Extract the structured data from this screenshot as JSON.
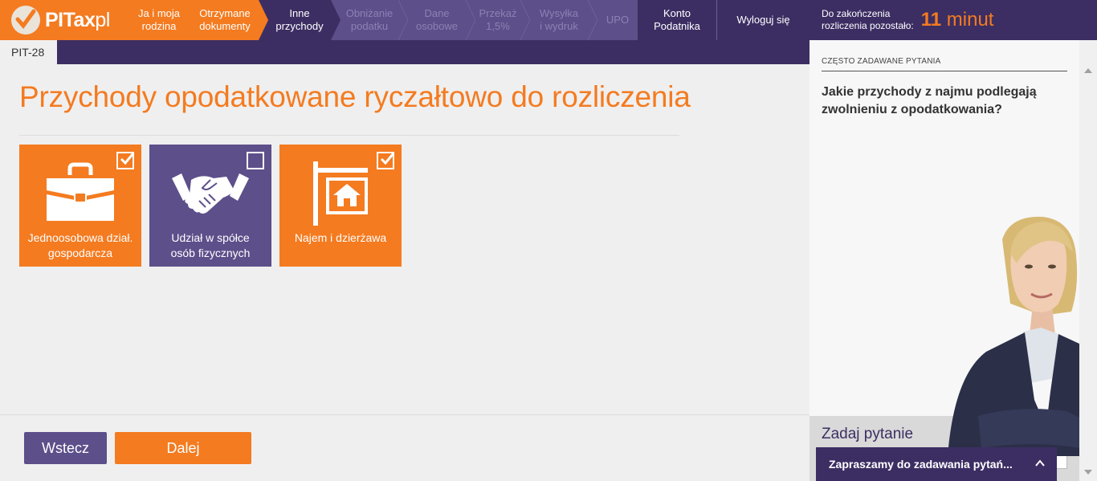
{
  "brand": {
    "name": "PITax",
    "suffix": "pl"
  },
  "nav": {
    "steps": [
      {
        "label_l1": "Ja i moja",
        "label_l2": "rodzina",
        "state": "done"
      },
      {
        "label_l1": "Otrzymane",
        "label_l2": "dokumenty",
        "state": "done"
      },
      {
        "label_l1": "Inne",
        "label_l2": "przychody",
        "state": "active"
      },
      {
        "label_l1": "Obniżanie",
        "label_l2": "podatku",
        "state": "disabled"
      },
      {
        "label_l1": "Dane",
        "label_l2": "osobowe",
        "state": "disabled"
      },
      {
        "label_l1": "Przekaż",
        "label_l2": "1,5%",
        "state": "disabled"
      },
      {
        "label_l1": "Wysyłka",
        "label_l2": "i wydruk",
        "state": "disabled"
      },
      {
        "label_l1": "UPO",
        "label_l2": "",
        "state": "disabled"
      }
    ],
    "account": {
      "label_l1": "Konto",
      "label_l2": "Podatnika"
    },
    "logout": "Wyloguj się"
  },
  "timer": {
    "label_l1": "Do zakończenia",
    "label_l2": "rozliczenia pozostało:",
    "number": "11",
    "unit": "minut"
  },
  "form_tab": "PIT-28",
  "main": {
    "title": "Przychody opodatkowane ryczałtowo do rozliczenia",
    "tiles": [
      {
        "label_l1": "Jednoosobowa dział.",
        "label_l2": "gospodarcza",
        "checked": true,
        "icon": "briefcase-icon",
        "color": "#f47b20"
      },
      {
        "label_l1": "Udział w spółce",
        "label_l2": "osób fizycznych",
        "checked": false,
        "icon": "handshake-icon",
        "color": "#5d4f8a"
      },
      {
        "label_l1": "Najem i dzierżawa",
        "label_l2": "",
        "checked": true,
        "icon": "house-sign-icon",
        "color": "#f47b20"
      }
    ]
  },
  "buttons": {
    "back": "Wstecz",
    "next": "Dalej"
  },
  "sidebar": {
    "faq_heading": "CZĘSTO ZADAWANE PYTANIA",
    "faq_question": "Jakie przychody z najmu podlegają zwolnieniu z opodatkowania?",
    "ask_title": "Zadaj pytanie",
    "chat_label": "Zapraszamy do zadawania pytań..."
  },
  "colors": {
    "orange": "#f47b20",
    "purple_dark": "#3c2e63",
    "purple": "#5d4f8a"
  }
}
